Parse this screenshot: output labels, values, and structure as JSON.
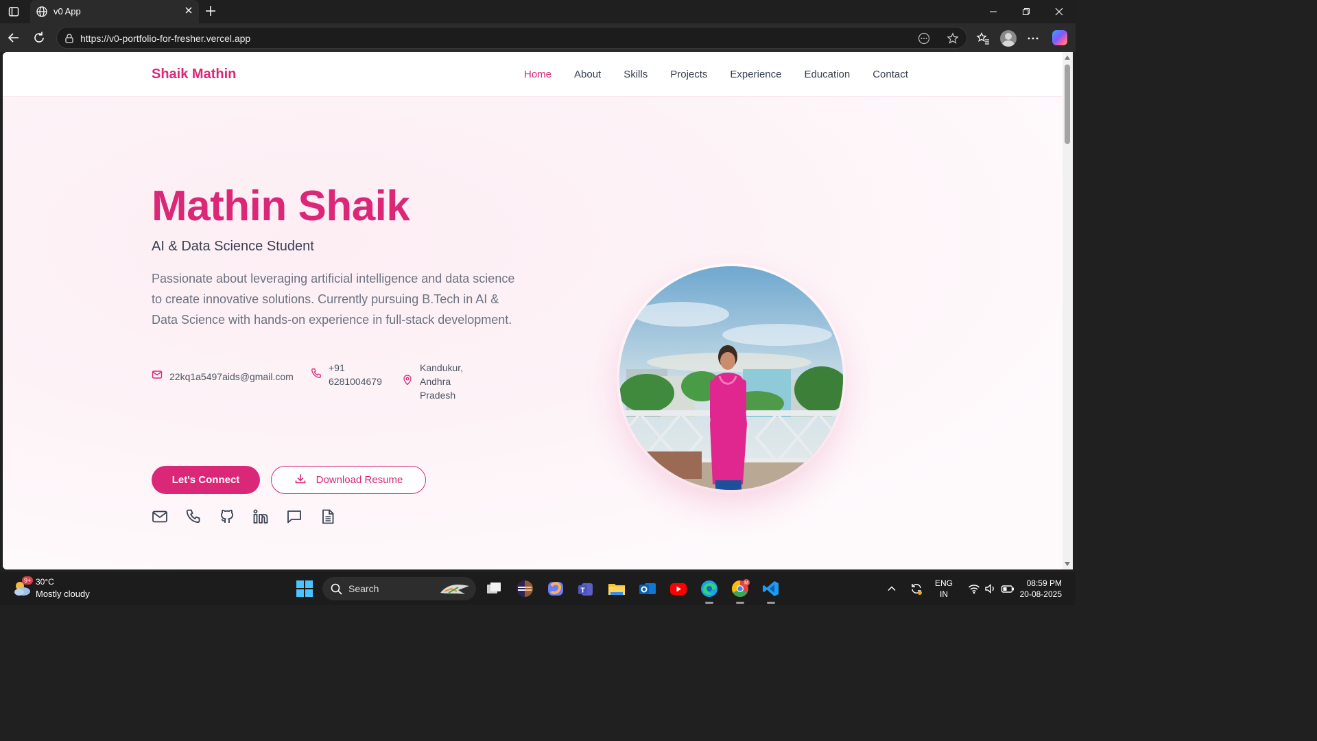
{
  "browser": {
    "tab_title": "v0 App",
    "url": "https://v0-portfolio-for-fresher.vercel.app"
  },
  "header": {
    "brand": "Shaik Mathin",
    "nav": [
      "Home",
      "About",
      "Skills",
      "Projects",
      "Experience",
      "Education",
      "Contact"
    ],
    "active_nav": "Home"
  },
  "hero": {
    "name": "Mathin Shaik",
    "role": "AI & Data Science Student",
    "description": "Passionate about leveraging artificial intelligence and data science to create innovative solutions. Currently pursuing B.Tech in AI & Data Science with hands-on experience in full-stack development.",
    "email": "22kq1a5497aids@gmail.com",
    "phone_line1": "+91",
    "phone_line2": "6281004679",
    "location_line1": "Kandukur, Andhra",
    "location_line2": "Pradesh",
    "primary_button": "Let's Connect",
    "secondary_button": "Download Resume",
    "social_icons": [
      "mail-icon",
      "phone-icon",
      "github-icon",
      "linkedin-icon",
      "message-icon",
      "document-icon"
    ]
  },
  "taskbar": {
    "weather_badge": "9+",
    "temperature": "30°C",
    "weather_condition": "Mostly cloudy",
    "search_label": "Search",
    "language_line1": "ENG",
    "language_line2": "IN",
    "time": "08:59 PM",
    "date": "20-08-2025"
  },
  "colors": {
    "accent": "#db2777",
    "text_dark": "#374151",
    "text_muted": "#6b7280"
  }
}
